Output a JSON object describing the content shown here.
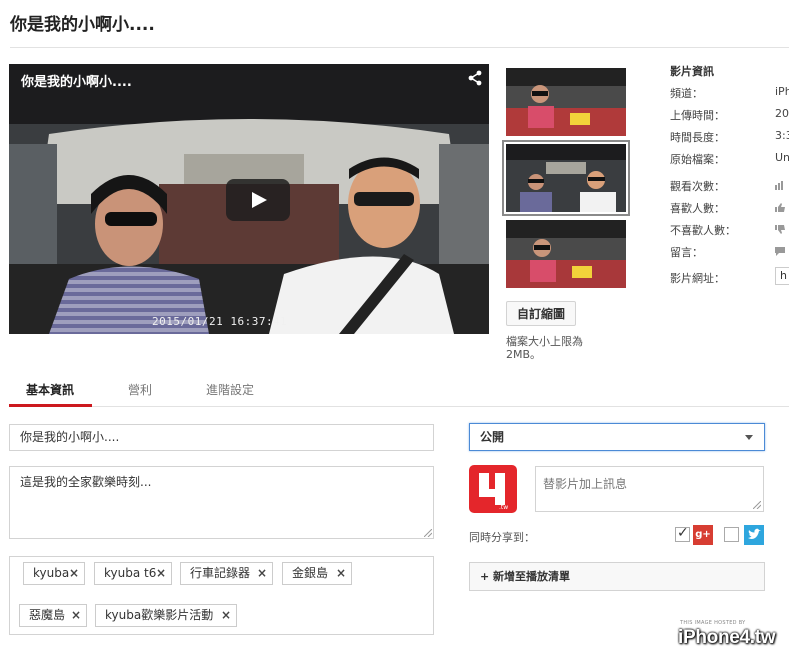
{
  "page": {
    "title": "你是我的小啊小...."
  },
  "player": {
    "title": "你是我的小啊小....",
    "timestamp": "2015/01/21 16:37:41"
  },
  "thumbnails": {
    "count": 3,
    "selected_index": 1,
    "custom_button": "自訂縮圖",
    "note": "檔案大小上限為 2MB。"
  },
  "video_info": {
    "heading": "影片資訊",
    "rows": [
      {
        "label": "頻道：",
        "value": "iPh"
      },
      {
        "label": "上傳時間：",
        "value": "20"
      },
      {
        "label": "時間長度：",
        "value": "3:3"
      },
      {
        "label": "原始檔案：",
        "value": "Un"
      },
      {
        "label": "觀看次數：",
        "icon": "bar-chart-icon"
      },
      {
        "label": "喜歡人數：",
        "icon": "thumbs-up-icon"
      },
      {
        "label": "不喜歡人數：",
        "icon": "thumbs-down-icon"
      },
      {
        "label": "留言：",
        "icon": "comment-icon"
      },
      {
        "label": "影片網址：",
        "value": "h"
      }
    ]
  },
  "tabs": [
    {
      "label": "基本資訊",
      "active": true
    },
    {
      "label": "營利",
      "active": false
    },
    {
      "label": "進階設定",
      "active": false
    }
  ],
  "form": {
    "title_value": "你是我的小啊小....",
    "description_value": "這是我的全家歡樂時刻...",
    "tags": [
      "kyuba",
      "kyuba t6",
      "行車記錄器",
      "金銀島",
      "惡魔島",
      "kyuba歡樂影片活動"
    ],
    "privacy": "公開",
    "message_placeholder": "替影片加上訊息",
    "share_label": "同時分享到：",
    "share_targets": [
      {
        "name": "google-plus",
        "checked": true,
        "glyph": "g+"
      },
      {
        "name": "twitter",
        "checked": false
      }
    ],
    "playlist_button": "+ 新增至播放清單"
  },
  "watermark": {
    "small": "THIS IMAGE HOSTED BY",
    "logo": "iPhone4.tw"
  },
  "colors": {
    "accent_red": "#cc181e",
    "focus_blue": "#4b8ad6",
    "gplus_red": "#d73d32",
    "twitter_blue": "#2ea6de"
  }
}
